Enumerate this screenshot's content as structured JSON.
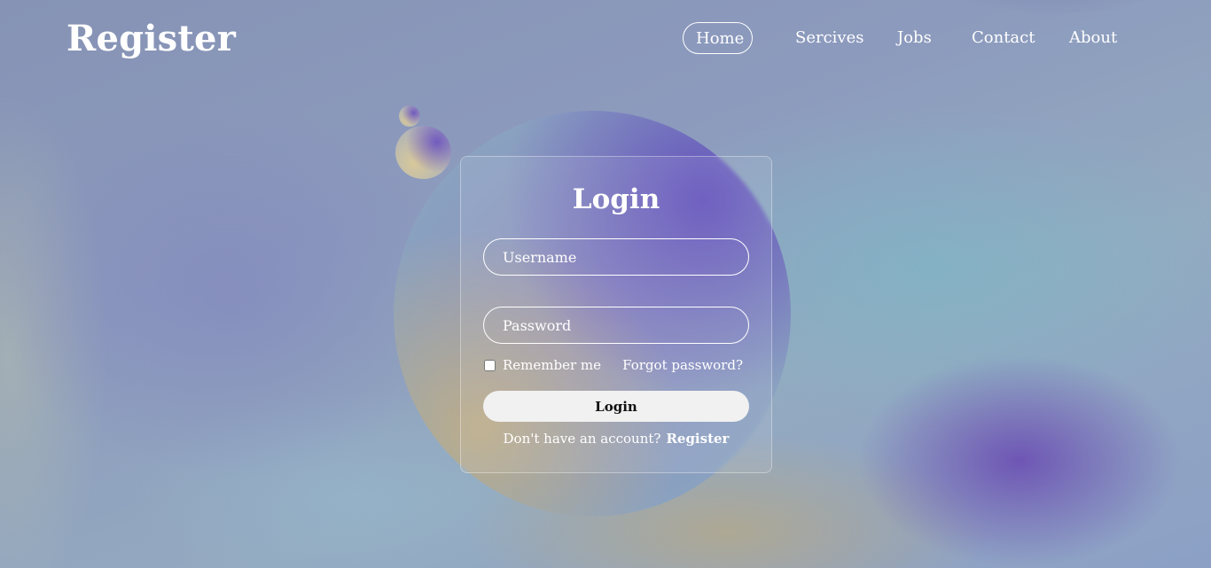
{
  "header": {
    "brand": "Register",
    "nav": [
      {
        "label": "Home",
        "active": true
      },
      {
        "label": "Sercives",
        "active": false
      },
      {
        "label": "Jobs",
        "active": false
      },
      {
        "label": "Contact",
        "active": false
      },
      {
        "label": "About",
        "active": false
      }
    ]
  },
  "login_form": {
    "title": "Login",
    "username_placeholder": "Username",
    "password_placeholder": "Password",
    "remember_label": "Remember me",
    "remember_checked": false,
    "forgot_label": "Forgot password?",
    "submit_label": "Login",
    "no_account_text": "Don't have an account?",
    "register_link": "Register"
  },
  "colors": {
    "text": "#ffffff",
    "button_bg": "#f1f1f1",
    "button_text": "#111111",
    "accent_purple": "#6848b2"
  }
}
